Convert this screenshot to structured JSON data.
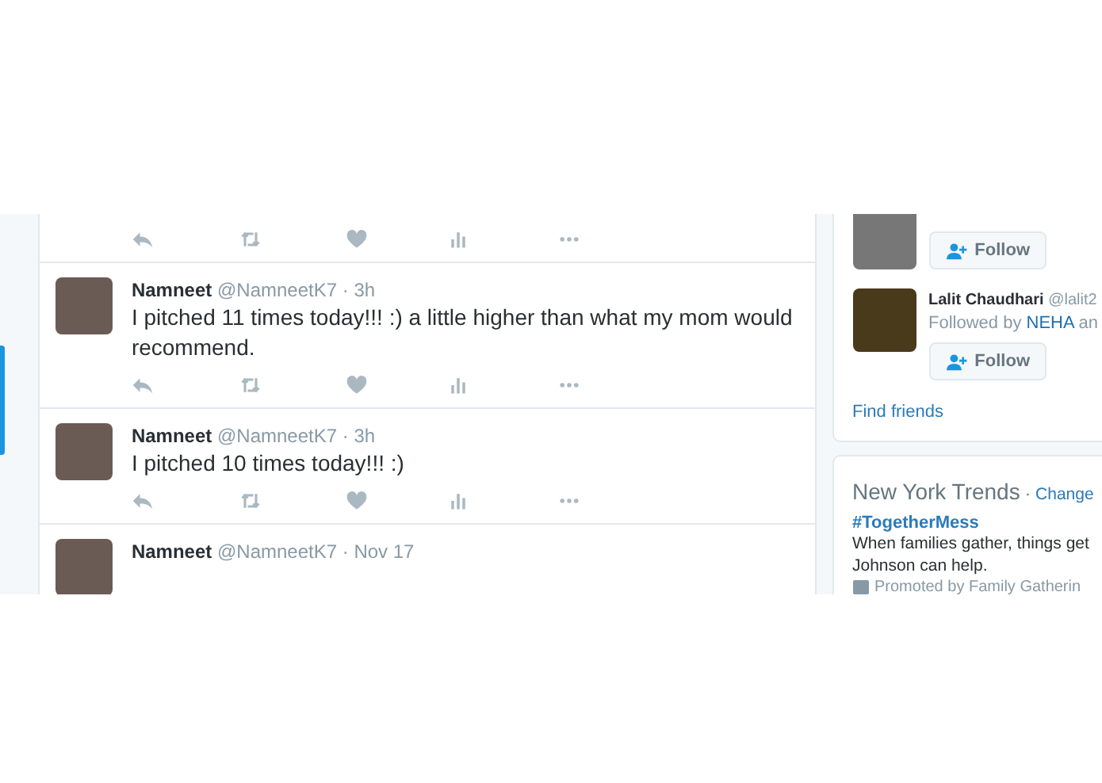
{
  "feed": {
    "tweets": [
      {
        "kind": "actions"
      },
      {
        "kind": "full",
        "name": "Namneet",
        "handle": "@NamneetK7",
        "time": "· 3h",
        "text": "I pitched 11 times today!!! :) a little higher than what my mom would recommend."
      },
      {
        "kind": "full",
        "name": "Namneet",
        "handle": "@NamneetK7",
        "time": "· 3h",
        "text": "I pitched 10 times today!!! :)"
      },
      {
        "kind": "header",
        "name": "Namneet",
        "handle": "@NamneetK7",
        "time": "· Nov 17"
      }
    ]
  },
  "who_to_follow": {
    "users": [
      {
        "kind": "button",
        "follow_label": "Follow"
      },
      {
        "kind": "full",
        "name": "Lalit Chaudhari",
        "handle": "@lalit2",
        "followed_by": "Followed by **NEHA** an",
        "follow_label": "Follow"
      }
    ],
    "find_friends": "Find friends"
  },
  "trends": {
    "title": "New York Trends",
    "separator": "·",
    "change": "Change",
    "items": [
      {
        "tag": "#TogetherMess",
        "lines": [
          "When families gather, things get",
          "Johnson can help."
        ],
        "promoted": "Promoted by Family Gatherin"
      }
    ]
  }
}
